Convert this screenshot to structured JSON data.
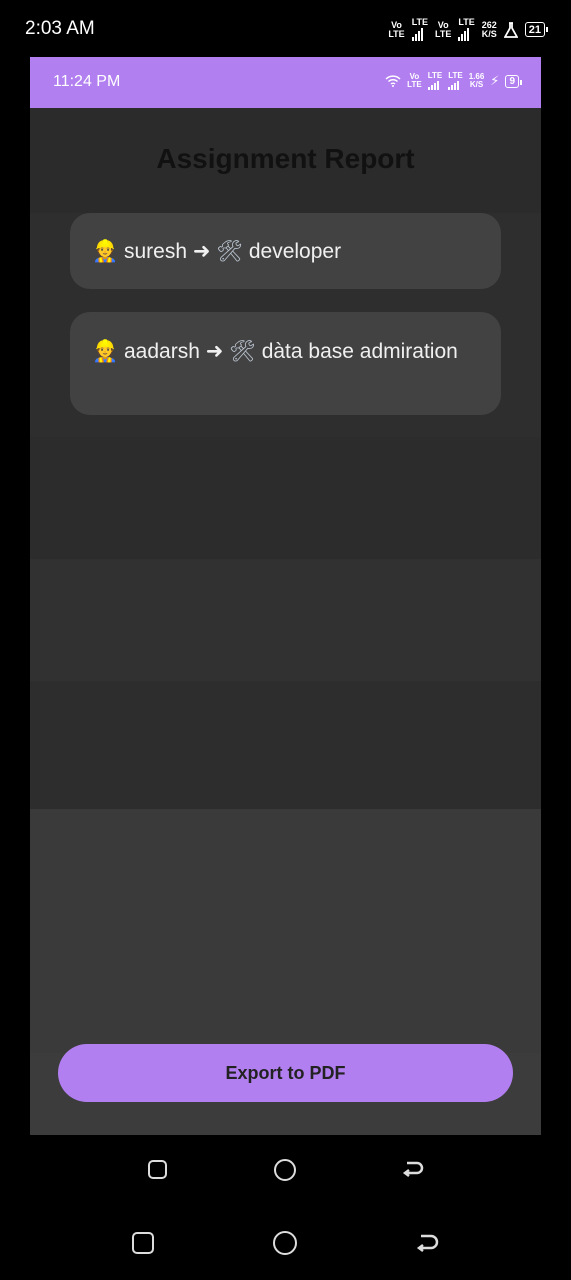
{
  "outer_status": {
    "time": "2:03 AM",
    "net1_top": "Vo",
    "net1_bottom": "LTE",
    "lte1": "LTE",
    "net2_top": "Vo",
    "net2_bottom": "LTE",
    "lte2": "LTE",
    "speed_top": "262",
    "speed_bottom": "K/S",
    "battery": "21"
  },
  "inner_status": {
    "time": "11:24 PM",
    "net_top": "Vo",
    "net_bottom": "LTE",
    "lte1": "LTE",
    "lte2": "LTE",
    "speed_top": "1.66",
    "speed_bottom": "K/S",
    "battery": "9",
    "color": "#b27ff0"
  },
  "page": {
    "title": "Assignment Report"
  },
  "assignments": [
    {
      "worker_icon": "👷",
      "name": "suresh",
      "arrow": "➜",
      "tool_icon": "🛠",
      "role": "developer"
    },
    {
      "worker_icon": "👷",
      "name": "aadarsh",
      "arrow": "➜",
      "tool_icon": "🛠",
      "role": "dàta base admiration"
    }
  ],
  "actions": {
    "export_label": "Export to PDF",
    "accent": "#b27ff0"
  },
  "nav_bar": {
    "icons": [
      "recent-apps-icon",
      "home-icon",
      "back-icon"
    ]
  }
}
